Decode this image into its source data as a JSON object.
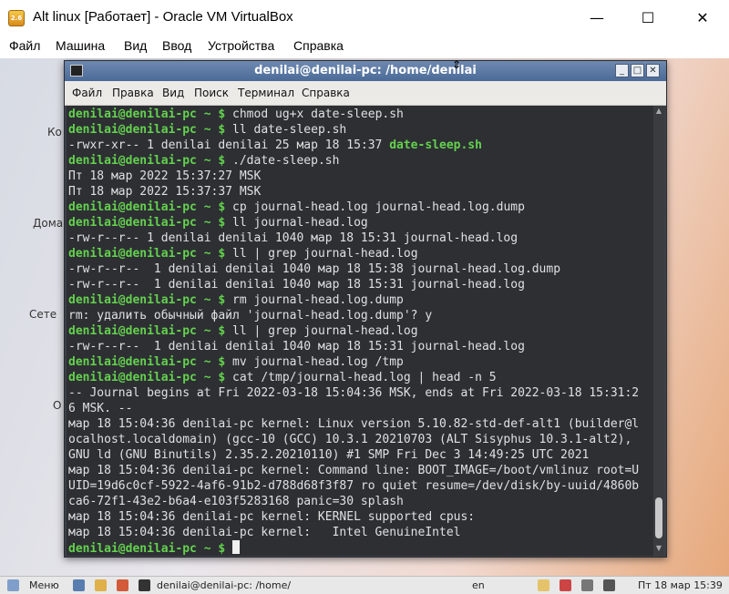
{
  "host": {
    "title": "Alt linux [Работает] - Oracle VM VirtualBox",
    "app_icon_text": "2.6",
    "controls": {
      "minimize": "—",
      "maximize": "☐",
      "close": "✕"
    },
    "menu": [
      "Файл",
      "Машина",
      "Вид",
      "Ввод",
      "Устройства",
      "Справка"
    ]
  },
  "desktop": {
    "labels": [
      "Ко",
      "Дома",
      "Сете",
      "О"
    ]
  },
  "terminal": {
    "title": "denilai@denilai-pc: /home/denilai",
    "menu": [
      "Файл",
      "Правка",
      "Вид",
      "Поиск",
      "Терминал",
      "Справка"
    ],
    "prompt_user": "denilai@denilai-pc",
    "prompt_dir": " ~ $ ",
    "lines": [
      {
        "type": "prompt",
        "cmd": "chmod ug+x date-sleep.sh"
      },
      {
        "type": "prompt",
        "cmd": "ll date-sleep.sh"
      },
      {
        "type": "out_exec",
        "text": "-rwxr-xr-- 1 denilai denilai 25 мар 18 15:37 ",
        "exec": "date-sleep.sh"
      },
      {
        "type": "prompt",
        "cmd": "./date-sleep.sh"
      },
      {
        "type": "out",
        "text": "Пт 18 мар 2022 15:37:27 MSK"
      },
      {
        "type": "out",
        "text": "Пт 18 мар 2022 15:37:37 MSK"
      },
      {
        "type": "prompt",
        "cmd": "cp journal-head.log journal-head.log.dump"
      },
      {
        "type": "prompt",
        "cmd": "ll journal-head.log"
      },
      {
        "type": "out",
        "text": "-rw-r--r-- 1 denilai denilai 1040 мар 18 15:31 journal-head.log"
      },
      {
        "type": "prompt",
        "cmd": "ll | grep journal-head.log"
      },
      {
        "type": "out",
        "text": "-rw-r--r--  1 denilai denilai 1040 мар 18 15:38 journal-head.log.dump"
      },
      {
        "type": "out",
        "text": "-rw-r--r--  1 denilai denilai 1040 мар 18 15:31 journal-head.log"
      },
      {
        "type": "prompt",
        "cmd": "rm journal-head.log.dump"
      },
      {
        "type": "out",
        "text": "rm: удалить обычный файл 'journal-head.log.dump'? y"
      },
      {
        "type": "prompt",
        "cmd": "ll | grep journal-head.log"
      },
      {
        "type": "out",
        "text": "-rw-r--r--  1 denilai denilai 1040 мар 18 15:31 journal-head.log"
      },
      {
        "type": "prompt",
        "cmd": "mv journal-head.log /tmp"
      },
      {
        "type": "prompt",
        "cmd": "cat /tmp/journal-head.log | head -n 5"
      },
      {
        "type": "out",
        "text": "-- Journal begins at Fri 2022-03-18 15:04:36 MSK, ends at Fri 2022-03-18 15:31:2"
      },
      {
        "type": "out",
        "text": "6 MSK. --"
      },
      {
        "type": "out",
        "text": "мар 18 15:04:36 denilai-pc kernel: Linux version 5.10.82-std-def-alt1 (builder@l"
      },
      {
        "type": "out",
        "text": "ocalhost.localdomain) (gcc-10 (GCC) 10.3.1 20210703 (ALT Sisyphus 10.3.1-alt2),"
      },
      {
        "type": "out",
        "text": "GNU ld (GNU Binutils) 2.35.2.20210110) #1 SMP Fri Dec 3 14:49:25 UTC 2021"
      },
      {
        "type": "out",
        "text": "мар 18 15:04:36 denilai-pc kernel: Command line: BOOT_IMAGE=/boot/vmlinuz root=U"
      },
      {
        "type": "out",
        "text": "UID=19d6c0cf-5922-4af6-91b2-d788d68f3f87 ro quiet resume=/dev/disk/by-uuid/4860b"
      },
      {
        "type": "out",
        "text": "ca6-72f1-43e2-b6a4-e103f5283168 panic=30 splash"
      },
      {
        "type": "out",
        "text": "мар 18 15:04:36 denilai-pc kernel: KERNEL supported cpus:"
      },
      {
        "type": "out",
        "text": "мар 18 15:04:36 denilai-pc kernel:   Intel GenuineIntel"
      },
      {
        "type": "prompt_active",
        "cmd": ""
      }
    ]
  },
  "taskbar": {
    "menu_label": "Меню",
    "task_label": "denilai@denilai-pc: /home/",
    "lang": "en",
    "clock": "Пт 18 мар 15:39"
  }
}
